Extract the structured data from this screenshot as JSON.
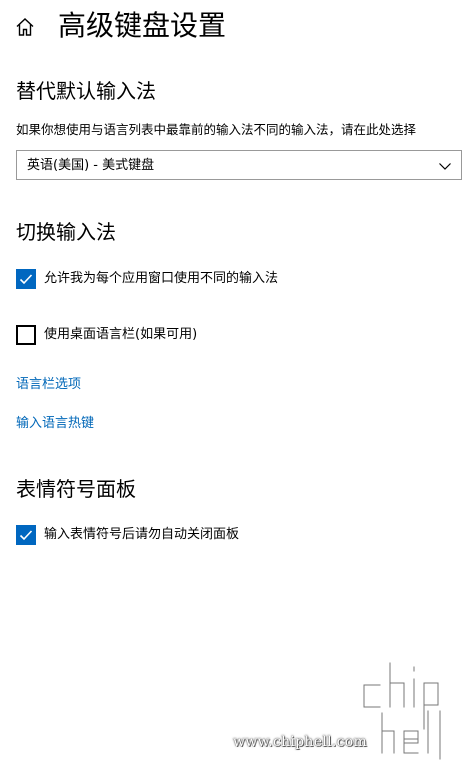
{
  "header": {
    "title": "高级键盘设置",
    "home_icon": "home-icon"
  },
  "override_section": {
    "title": "替代默认输入法",
    "description": "如果你想使用与语言列表中最靠前的输入法不同的输入法，请在此处选择",
    "select": {
      "value": "英语(美国) - 美式键盘",
      "icon": "chevron-down-icon"
    }
  },
  "switch_section": {
    "title": "切换输入法",
    "checkbox_per_app": {
      "label": "允许我为每个应用窗口使用不同的输入法",
      "checked": true
    },
    "checkbox_language_bar": {
      "label": "使用桌面语言栏(如果可用)",
      "checked": false
    },
    "link_language_bar_options": "语言栏选项",
    "link_hotkeys": "输入语言热键"
  },
  "emoji_section": {
    "title": "表情符号面板",
    "checkbox_auto_close": {
      "label": "输入表情符号后请勿自动关闭面板",
      "checked": true
    }
  },
  "watermark": {
    "url": "www.chiphell.com",
    "logo_text": "chip hell"
  },
  "colors": {
    "accent": "#0067c0",
    "link": "#0067b8"
  }
}
